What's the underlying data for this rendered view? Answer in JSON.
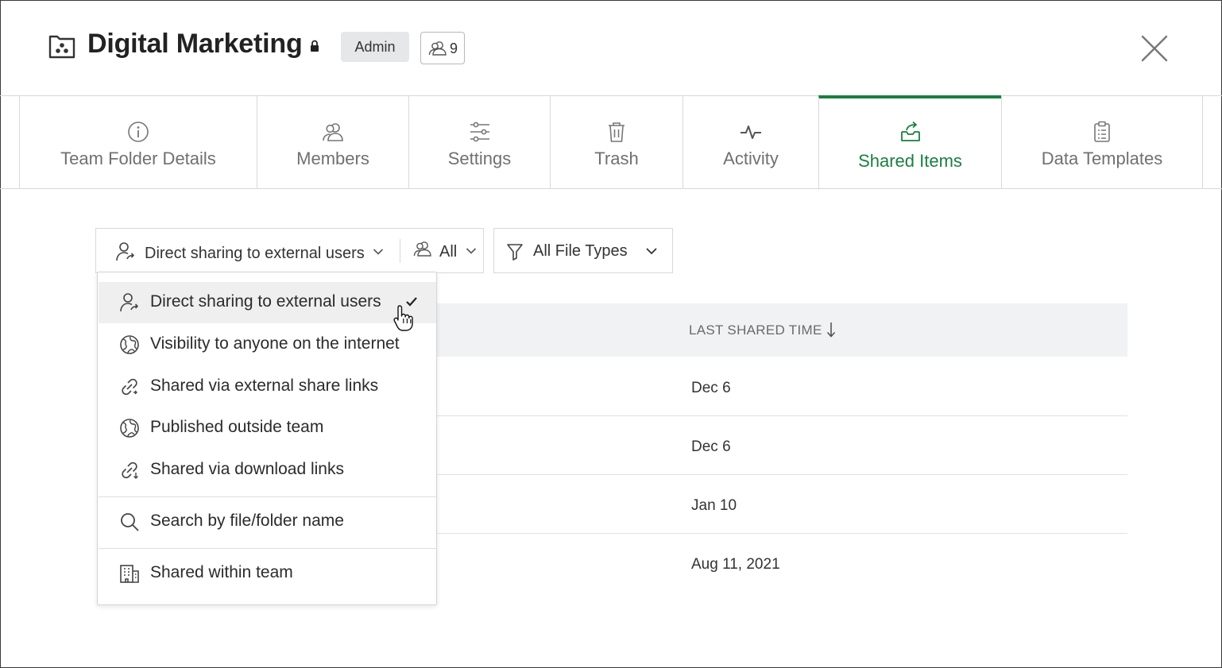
{
  "header": {
    "title": "Digital Marketing",
    "role_badge": "Admin",
    "member_count": "9"
  },
  "tabs": [
    {
      "label": "Team Folder Details",
      "icon": "info-icon",
      "active": false
    },
    {
      "label": "Members",
      "icon": "members-icon",
      "active": false
    },
    {
      "label": "Settings",
      "icon": "sliders-icon",
      "active": false
    },
    {
      "label": "Trash",
      "icon": "trash-icon",
      "active": false
    },
    {
      "label": "Activity",
      "icon": "activity-icon",
      "active": false
    },
    {
      "label": "Shared Items",
      "icon": "share-tray-icon",
      "active": true
    },
    {
      "label": "Data Templates",
      "icon": "clipboard-icon",
      "active": false
    }
  ],
  "filters": {
    "share_type": "Direct sharing to external users",
    "member": "All",
    "file_type": "All File Types"
  },
  "table": {
    "columns": [
      "LAST SHARED TIME"
    ],
    "sort_direction": "descending",
    "rows": [
      {
        "last_shared_time": "Dec 6"
      },
      {
        "last_shared_time": "Dec 6"
      },
      {
        "last_shared_time": "Jan 10"
      },
      {
        "last_shared_time": "Aug 11, 2021"
      }
    ]
  },
  "dropdown": {
    "items": [
      {
        "label": "Direct sharing to external users",
        "icon": "external-user-icon",
        "selected": true
      },
      {
        "label": "Visibility to anyone on the internet",
        "icon": "globe-icon",
        "selected": false
      },
      {
        "label": "Shared via external share links",
        "icon": "link-icon",
        "selected": false
      },
      {
        "label": "Published outside team",
        "icon": "globe-icon",
        "selected": false
      },
      {
        "label": "Shared via download links",
        "icon": "download-link-icon",
        "selected": false
      }
    ],
    "search_label": "Search by file/folder name",
    "team_label": "Shared within team"
  },
  "colors": {
    "accent": "#1a7f3f",
    "badge_bg": "#e6e7e8",
    "table_header_bg": "#f1f2f3",
    "selected_item_bg": "#efeff0"
  }
}
